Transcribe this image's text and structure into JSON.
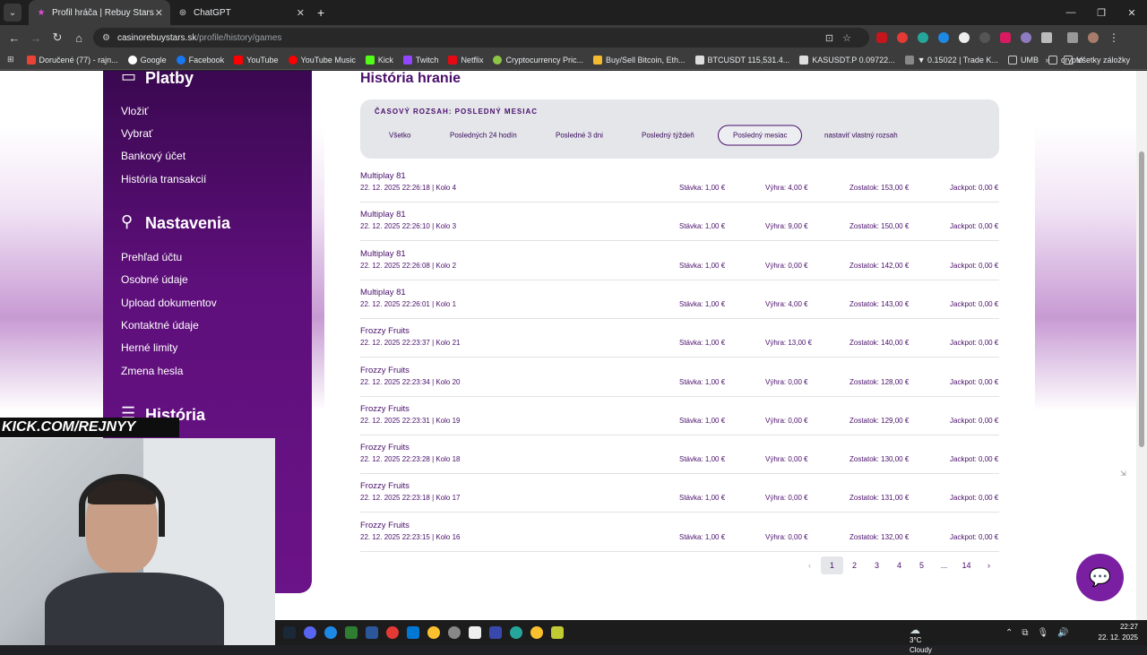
{
  "browser": {
    "tabs": [
      {
        "label": "Profil hráča | Rebuy Stars casino",
        "active": true
      },
      {
        "label": "ChatGPT",
        "active": false
      }
    ],
    "url_domain": "casinorebuystars.sk",
    "url_path": "/profile/history/games",
    "bookmarks": [
      "Doručené (77) - rajn...",
      "Google",
      "Facebook",
      "YouTube",
      "YouTube Music",
      "Kick",
      "Twitch",
      "Netflix",
      "Cryptocurrency Pric...",
      "Buy/Sell Bitcoin, Eth...",
      "BTCUSDT 115,531.4...",
      "KASUSDT.P 0.09722...",
      "▼ 0.15022 | Trade K...",
      "UMB",
      "crypto"
    ],
    "bookmarks_all": "Všetky záložky"
  },
  "sidebar": {
    "platby": {
      "title": "Platby",
      "items": [
        "Vložiť",
        "Vybrať",
        "Bankový účet",
        "História transakcií"
      ]
    },
    "nastavenia": {
      "title": "Nastavenia",
      "items": [
        "Prehľad účtu",
        "Osobné údaje",
        "Upload dokumentov",
        "Kontaktné údaje",
        "Herné limity",
        "Zmena hesla"
      ]
    },
    "historia": {
      "title": "História"
    }
  },
  "main": {
    "title": "História hranie",
    "range_label": "ČASOVÝ ROZSAH: POSLEDNÝ MESIAC",
    "filters": [
      "Všetko",
      "Posledných 24 hodín",
      "Posledné 3 dni",
      "Posledný týždeň",
      "Posledný mesiac",
      "nastaviť vlastný rozsah"
    ],
    "selected_filter": "Posledný mesiac",
    "games": [
      {
        "name": "Multiplay 81",
        "date": "22. 12. 2025 22:26:18 | Kolo 4",
        "stake": "Stávka: 1,00 €",
        "win": "Výhra: 4,00 €",
        "balance": "Zostatok: 153,00 €",
        "jackpot": "Jackpot: 0,00 €"
      },
      {
        "name": "Multiplay 81",
        "date": "22. 12. 2025 22:26:10 | Kolo 3",
        "stake": "Stávka: 1,00 €",
        "win": "Výhra: 9,00 €",
        "balance": "Zostatok: 150,00 €",
        "jackpot": "Jackpot: 0,00 €"
      },
      {
        "name": "Multiplay 81",
        "date": "22. 12. 2025 22:26:08 | Kolo 2",
        "stake": "Stávka: 1,00 €",
        "win": "Výhra: 0,00 €",
        "balance": "Zostatok: 142,00 €",
        "jackpot": "Jackpot: 0,00 €"
      },
      {
        "name": "Multiplay 81",
        "date": "22. 12. 2025 22:26:01 | Kolo 1",
        "stake": "Stávka: 1,00 €",
        "win": "Výhra: 4,00 €",
        "balance": "Zostatok: 143,00 €",
        "jackpot": "Jackpot: 0,00 €"
      },
      {
        "name": "Frozzy Fruits",
        "date": "22. 12. 2025 22:23:37 | Kolo 21",
        "stake": "Stávka: 1,00 €",
        "win": "Výhra: 13,00 €",
        "balance": "Zostatok: 140,00 €",
        "jackpot": "Jackpot: 0,00 €"
      },
      {
        "name": "Frozzy Fruits",
        "date": "22. 12. 2025 22:23:34 | Kolo 20",
        "stake": "Stávka: 1,00 €",
        "win": "Výhra: 0,00 €",
        "balance": "Zostatok: 128,00 €",
        "jackpot": "Jackpot: 0,00 €"
      },
      {
        "name": "Frozzy Fruits",
        "date": "22. 12. 2025 22:23:31 | Kolo 19",
        "stake": "Stávka: 1,00 €",
        "win": "Výhra: 0,00 €",
        "balance": "Zostatok: 129,00 €",
        "jackpot": "Jackpot: 0,00 €"
      },
      {
        "name": "Frozzy Fruits",
        "date": "22. 12. 2025 22:23:28 | Kolo 18",
        "stake": "Stávka: 1,00 €",
        "win": "Výhra: 0,00 €",
        "balance": "Zostatok: 130,00 €",
        "jackpot": "Jackpot: 0,00 €"
      },
      {
        "name": "Frozzy Fruits",
        "date": "22. 12. 2025 22:23:18 | Kolo 17",
        "stake": "Stávka: 1,00 €",
        "win": "Výhra: 0,00 €",
        "balance": "Zostatok: 131,00 €",
        "jackpot": "Jackpot: 0,00 €"
      },
      {
        "name": "Frozzy Fruits",
        "date": "22. 12. 2025 22:23:15 | Kolo 16",
        "stake": "Stávka: 1,00 €",
        "win": "Výhra: 0,00 €",
        "balance": "Zostatok: 132,00 €",
        "jackpot": "Jackpot: 0,00 €"
      }
    ],
    "pagination": {
      "prev": "‹",
      "pages": [
        "1",
        "2",
        "3",
        "4",
        "5",
        "...",
        "14"
      ],
      "current": "1",
      "next": "›"
    }
  },
  "overlay": {
    "stream_tag": "KICK.COM/REJNYY"
  },
  "taskbar": {
    "temp": "3°C",
    "weather": "Cloudy",
    "time": "22:27",
    "date": "22. 12. 2025"
  }
}
